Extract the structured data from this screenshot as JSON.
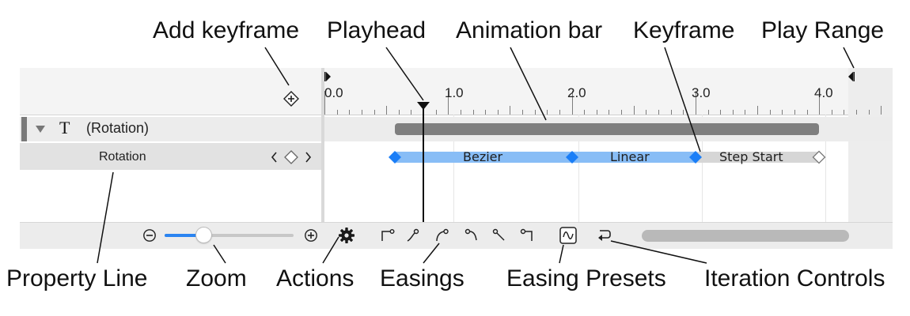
{
  "callouts": {
    "add_keyframe": "Add keyframe",
    "playhead": "Playhead",
    "animation_bar": "Animation bar",
    "keyframe": "Keyframe",
    "play_range": "Play Range",
    "property_line": "Property Line",
    "zoom": "Zoom",
    "actions": "Actions",
    "easings": "Easings",
    "easing_presets": "Easing Presets",
    "iteration_controls": "Iteration Controls"
  },
  "ruler": {
    "labels": [
      "0.0",
      "1.0",
      "2.0",
      "3.0",
      "4.0"
    ]
  },
  "tracks": {
    "group_title": "(Rotation)",
    "group_type_glyph": "T",
    "property_name": "Rotation"
  },
  "segments": {
    "s1": "Bezier",
    "s2": "Linear",
    "s3": "Step Start"
  },
  "playhead_time": 0.8,
  "zoom_level": 0.3,
  "colors": {
    "keyframe": "#1a7ef7",
    "segment": "#88bdf6",
    "step_segment": "#d6d6d6",
    "animation_bar": "#7f7f7f",
    "zoom_fill": "#2b84f1"
  }
}
